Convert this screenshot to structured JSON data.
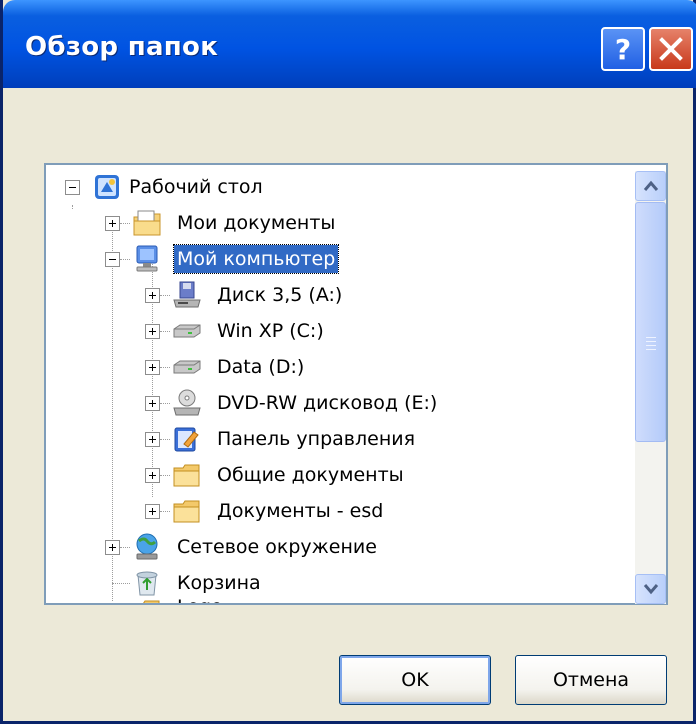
{
  "window": {
    "title": "Обзор папок",
    "help_icon": "question-mark-icon",
    "close_icon": "close-x-icon"
  },
  "tree": {
    "items": [
      {
        "label": "Рабочий стол",
        "icon": "desktop-icon",
        "expander": "minus"
      },
      {
        "label": "Мои документы",
        "icon": "my-documents-icon",
        "expander": "plus"
      },
      {
        "label": "Мой компьютер",
        "icon": "my-computer-icon",
        "expander": "minus",
        "selected": true
      },
      {
        "label": "Диск 3,5 (A:)",
        "icon": "floppy-drive-icon",
        "expander": "plus"
      },
      {
        "label": "Win XP (C:)",
        "icon": "hard-drive-icon",
        "expander": "plus"
      },
      {
        "label": "Data (D:)",
        "icon": "hard-drive-icon",
        "expander": "plus"
      },
      {
        "label": "DVD-RW дисковод (E:)",
        "icon": "dvd-drive-icon",
        "expander": "plus"
      },
      {
        "label": "Панель управления",
        "icon": "control-panel-icon",
        "expander": "plus"
      },
      {
        "label": "Общие документы",
        "icon": "folder-icon",
        "expander": "plus"
      },
      {
        "label": "Документы - esd",
        "icon": "folder-icon",
        "expander": "plus"
      },
      {
        "label": "Сетевое окружение",
        "icon": "network-places-icon",
        "expander": "plus"
      },
      {
        "label": "Корзина",
        "icon": "recycle-bin-icon",
        "expander": "none"
      },
      {
        "label": "Lego",
        "icon": "folder-icon",
        "expander": "none"
      }
    ]
  },
  "buttons": {
    "ok": "OK",
    "cancel": "Отмена"
  },
  "colors": {
    "titlebar": "#0053e2",
    "selection": "#316ac5",
    "dialog_bg": "#ece9d8"
  }
}
